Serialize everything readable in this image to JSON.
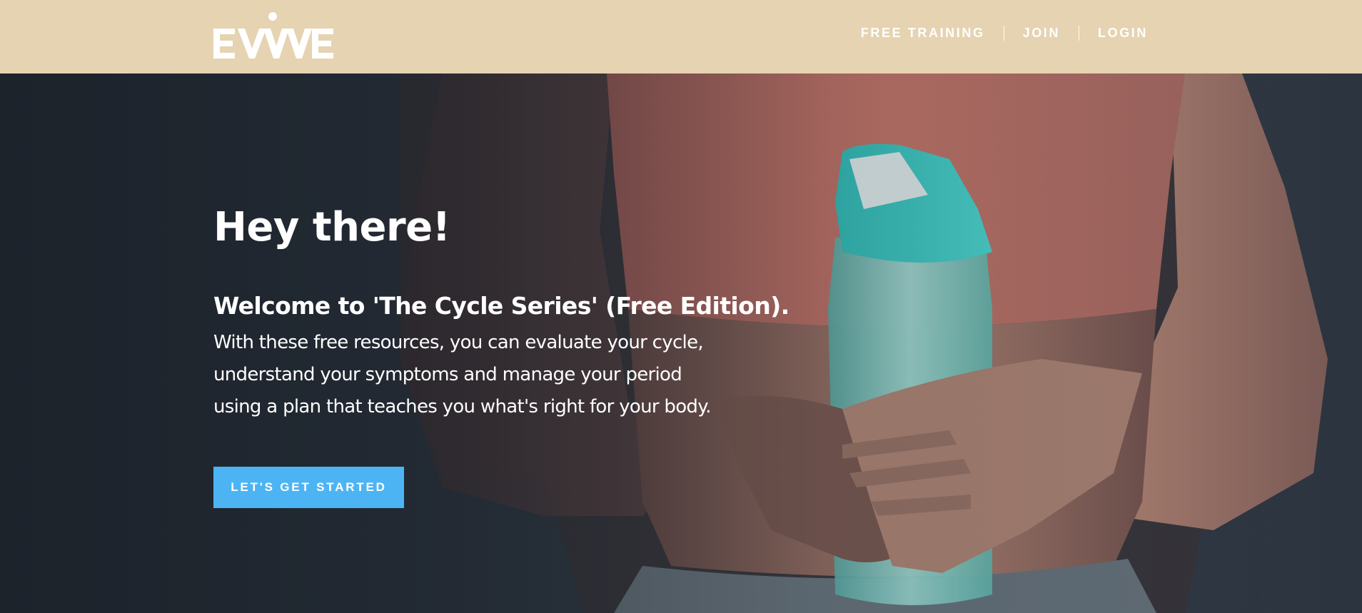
{
  "header": {
    "logo_text": "EVVE",
    "background_color": "#e6d3b1",
    "nav": {
      "items": [
        {
          "label": "FREE TRAINING"
        },
        {
          "label": "JOIN"
        },
        {
          "label": "LOGIN"
        }
      ]
    }
  },
  "hero": {
    "title": "Hey there!",
    "subtitle": "Welcome to 'The Cycle Series' (Free Edition).",
    "body_lines": [
      "With these free resources, you can evaluate your cycle,",
      "understand your symptoms and manage your period",
      "using a plan that teaches you what's right for your body."
    ],
    "cta_label": "LET'S GET STARTED",
    "cta_color": "#4db4f4",
    "background_image": "woman-holding-water-bottle-photo"
  }
}
